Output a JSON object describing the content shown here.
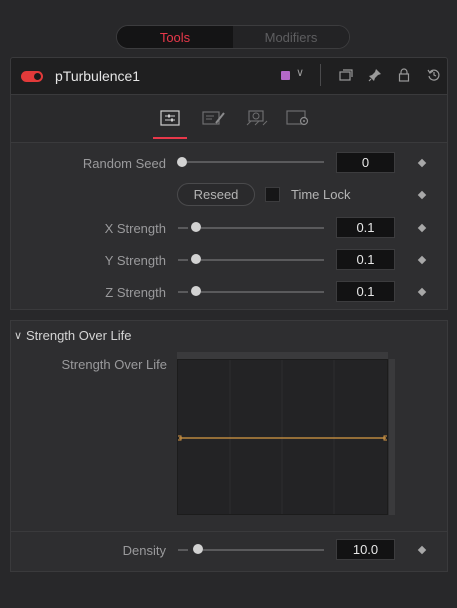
{
  "tabs": {
    "tools": "Tools",
    "modifiers": "Modifiers"
  },
  "node": {
    "name": "pTurbulence1",
    "color": "#b468c8"
  },
  "icons": {
    "header": [
      "window-icon",
      "pin-icon",
      "lock-icon",
      "reset-icon"
    ],
    "subtabs": [
      "controls-icon",
      "settings-edit-icon",
      "effect-mask-icon",
      "common-settings-icon"
    ]
  },
  "controls": {
    "random_seed": {
      "label": "Random Seed",
      "value": "0"
    },
    "reseed_label": "Reseed",
    "time_lock_label": "Time Lock",
    "x_strength": {
      "label": "X Strength",
      "value": "0.1"
    },
    "y_strength": {
      "label": "Y Strength",
      "value": "0.1"
    },
    "z_strength": {
      "label": "Z Strength",
      "value": "0.1"
    }
  },
  "strength_over_life": {
    "section_title": "Strength Over Life",
    "label": "Strength Over Life",
    "curve_level": 0.5
  },
  "density": {
    "label": "Density",
    "value": "10.0"
  },
  "colors": {
    "accent": "#e8384a",
    "curve": "#d89a45"
  }
}
